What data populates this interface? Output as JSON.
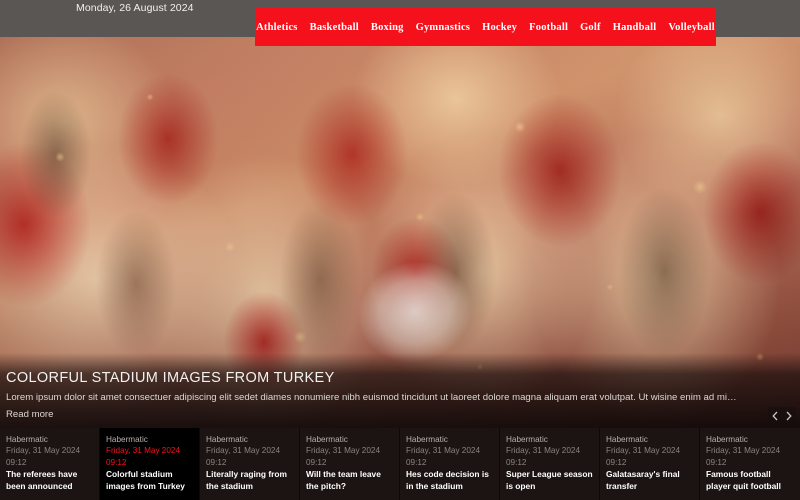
{
  "topbar": {
    "date": "Monday, 26 August 2024"
  },
  "nav": {
    "items": [
      {
        "label": "Athletics"
      },
      {
        "label": "Basketball"
      },
      {
        "label": "Boxing"
      },
      {
        "label": "Gymnastics"
      },
      {
        "label": "Hockey"
      },
      {
        "label": "Football"
      },
      {
        "label": "Golf"
      },
      {
        "label": "Handball"
      },
      {
        "label": "Volleyball"
      }
    ],
    "background_color": "#f5111c"
  },
  "hero": {
    "title": "COLORFUL STADIUM IMAGES FROM TURKEY",
    "description": "Lorem ipsum dolor sit amet consectuer adipiscing elit sedet diames nonumiere nibh euismod tincidunt ut laoreet dolore magna aliquam erat volutpat. Ut wisine enim ad minim veniam, quis nostrud exerci t...",
    "read_more": "Read more",
    "image_alt": "Crowd of sports fans cheering in stadium"
  },
  "carousel": {
    "prev_icon": "chevron-left-icon",
    "next_icon": "chevron-right-icon"
  },
  "news": {
    "cards": [
      {
        "source": "Habermatic",
        "date": "Friday, 31 May 2024",
        "time": "09:12",
        "title": "The referees have been announced",
        "active": false
      },
      {
        "source": "Habermatic",
        "date": "Friday, 31 May 2024",
        "time": "09:12",
        "title": "Colorful stadium images from Turkey",
        "active": true
      },
      {
        "source": "Habermatic",
        "date": "Friday, 31 May 2024",
        "time": "09:12",
        "title": "Literally raging from the stadium",
        "active": false
      },
      {
        "source": "Habermatic",
        "date": "Friday, 31 May 2024",
        "time": "09:12",
        "title": "Will the team leave the pitch?",
        "active": false
      },
      {
        "source": "Habermatic",
        "date": "Friday, 31 May 2024",
        "time": "09:12",
        "title": "Hes code decision is in the stadium",
        "active": false
      },
      {
        "source": "Habermatic",
        "date": "Friday, 31 May 2024",
        "time": "09:12",
        "title": "Super League season is open",
        "active": false
      },
      {
        "source": "Habermatic",
        "date": "Friday, 31 May 2024",
        "time": "09:12",
        "title": "Galatasaray's final transfer",
        "active": false
      },
      {
        "source": "Habermatic",
        "date": "Friday, 31 May 2024",
        "time": "09:12",
        "title": "Famous football player quit football",
        "active": false
      }
    ]
  },
  "colors": {
    "accent_red": "#f5111c",
    "topbar_gray": "#5a5653",
    "card_bg": "#1b1412",
    "card_active_bg": "#000000"
  }
}
